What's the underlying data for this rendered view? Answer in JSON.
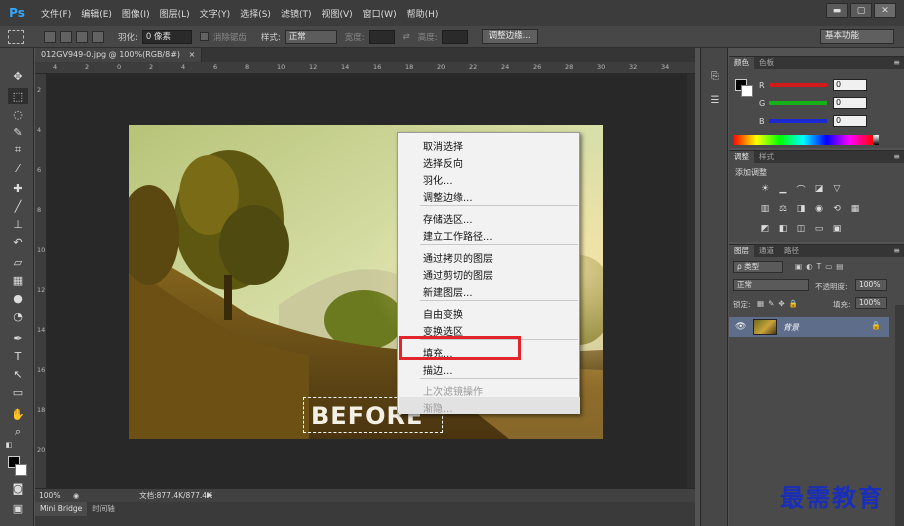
{
  "app": {
    "logo": "Ps",
    "menus": [
      "文件(F)",
      "编辑(E)",
      "图像(I)",
      "图层(L)",
      "文字(Y)",
      "选择(S)",
      "滤镜(T)",
      "视图(V)",
      "窗口(W)",
      "帮助(H)"
    ],
    "window_buttons": [
      "▬",
      "▢",
      "✕"
    ]
  },
  "options_bar": {
    "feather_label": "羽化:",
    "feather_value": "0 像素",
    "antialias_label": "消除锯齿",
    "style_label": "样式:",
    "style_value": "正常",
    "width_label": "宽度:",
    "height_label": "高度:",
    "refine_button": "调整边缘...",
    "workspace": "基本功能"
  },
  "document": {
    "tab_title": "012GV949-0.jpg @ 100%(RGB/8#)",
    "tab_close": "×",
    "ruler_h_ticks": [
      "4",
      "2",
      "0",
      "2",
      "4",
      "6",
      "8",
      "10",
      "12",
      "14",
      "16",
      "18",
      "20",
      "22",
      "24",
      "26",
      "28",
      "30",
      "32",
      "34"
    ],
    "ruler_v_ticks": [
      "2",
      "4",
      "6",
      "8",
      "10",
      "12",
      "14",
      "16",
      "18",
      "20"
    ],
    "overlay_text": "BEFORE"
  },
  "context_menu": {
    "items": [
      {
        "label": "取消选择",
        "disabled": false
      },
      {
        "label": "选择反向",
        "disabled": false
      },
      {
        "label": "羽化...",
        "disabled": false
      },
      {
        "label": "调整边缘...",
        "disabled": false
      },
      {
        "label": "存储选区...",
        "disabled": false
      },
      {
        "label": "建立工作路径...",
        "disabled": false
      },
      {
        "label": "通过拷贝的图层",
        "disabled": false
      },
      {
        "label": "通过剪切的图层",
        "disabled": false
      },
      {
        "label": "新建图层...",
        "disabled": false
      },
      {
        "label": "自由变换",
        "disabled": false
      },
      {
        "label": "变换选区",
        "disabled": false
      },
      {
        "label": "填充...",
        "disabled": false,
        "highlighted": true
      },
      {
        "label": "描边...",
        "disabled": false
      },
      {
        "label": "上次滤镜操作",
        "disabled": true
      },
      {
        "label": "渐隐...",
        "disabled": true
      }
    ]
  },
  "status_bar": {
    "zoom": "100%",
    "doc_info": "文档:877.4K/877.4K",
    "arrow": "▶"
  },
  "bottom_tabs": [
    "Mini Bridge",
    "时间轴"
  ],
  "color_panel": {
    "tabs": [
      "颜色",
      "色板"
    ],
    "channels": [
      {
        "letter": "R",
        "value": "0",
        "track_color": "#d21a1a"
      },
      {
        "letter": "G",
        "value": "0",
        "track_color": "#18b018"
      },
      {
        "letter": "B",
        "value": "0",
        "track_color": "#1a2ad0"
      }
    ]
  },
  "adjustments_panel": {
    "tabs": [
      "调整",
      "样式"
    ],
    "title": "添加调整"
  },
  "layers_panel": {
    "tabs": [
      "图层",
      "通道",
      "路径"
    ],
    "kind_filter": "ρ 类型",
    "blend_mode": "正常",
    "opacity_label": "不透明度:",
    "opacity_value": "100%",
    "lock_label": "锁定:",
    "fill_label": "填充:",
    "fill_value": "100%",
    "layer_name": "背景",
    "eye_icon": "👁",
    "lock_icon": "🔒"
  },
  "watermark": "最需教育",
  "colors": {
    "highlight": "#e3242b",
    "watermark": "#1a2fb8",
    "selected_layer": "#5e6e8a"
  }
}
